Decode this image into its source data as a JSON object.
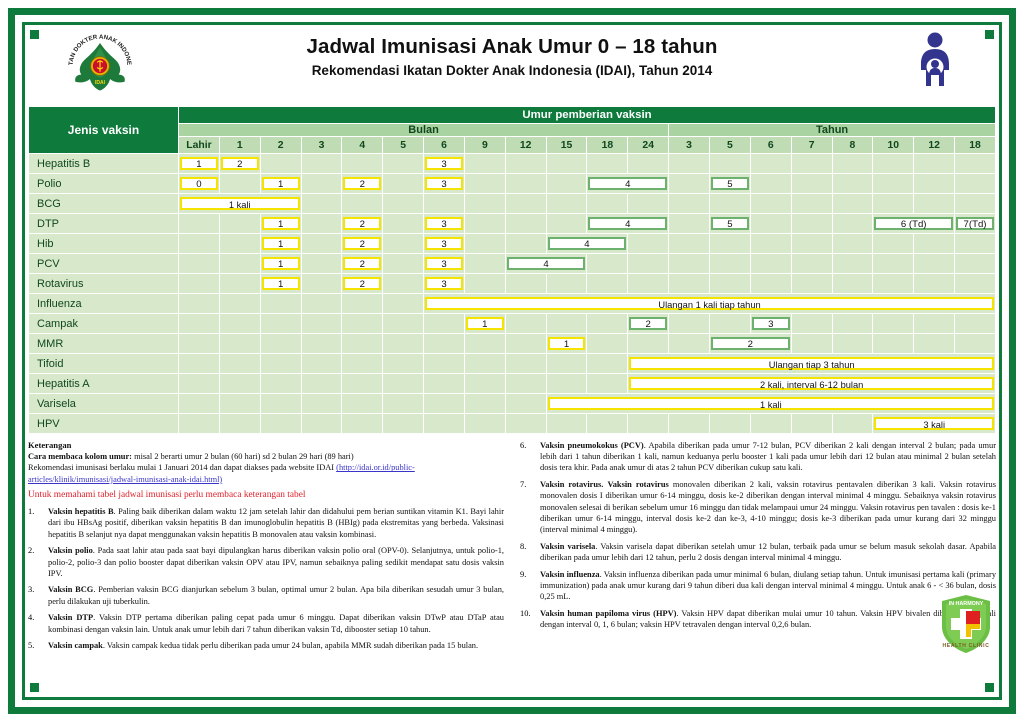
{
  "header": {
    "title": "Jadwal Imunisasi Anak Umur 0 – 18 tahun",
    "subtitle": "Rekomendasi Ikatan Dokter Anak Indonesia (IDAI), Tahun 2014",
    "logo_alt": "idai-logo",
    "logo_text_ring": "IKATAN DOKTER ANAK INDONESIA",
    "logo_text_bottom": "IDAI",
    "parent_icon_alt": "parent-and-child-icon"
  },
  "table": {
    "vaccine_header": "Jenis vaksin",
    "age_header": "Umur pemberian vaksin",
    "month_band": "Bulan",
    "year_band": "Tahun",
    "month_cols": [
      "Lahir",
      "1",
      "2",
      "3",
      "4",
      "5",
      "6",
      "9",
      "12",
      "15",
      "18",
      "24"
    ],
    "year_cols": [
      "3",
      "5",
      "6",
      "7",
      "8",
      "10",
      "12",
      "18"
    ],
    "rows": [
      {
        "name": "Hepatitis  B",
        "cells": [
          {
            "col": 0,
            "span": 1,
            "label": "1",
            "style": "y"
          },
          {
            "col": 1,
            "span": 1,
            "label": "2",
            "style": "y"
          },
          {
            "col": 6,
            "span": 1,
            "label": "3",
            "style": "y"
          }
        ]
      },
      {
        "name": "Polio",
        "cells": [
          {
            "col": 0,
            "span": 1,
            "label": "0",
            "style": "y"
          },
          {
            "col": 2,
            "span": 1,
            "label": "1",
            "style": "y"
          },
          {
            "col": 4,
            "span": 1,
            "label": "2",
            "style": "y"
          },
          {
            "col": 6,
            "span": 1,
            "label": "3",
            "style": "y"
          },
          {
            "col": 10,
            "span": 2,
            "label": "4",
            "style": "g"
          },
          {
            "col": 13,
            "span": 1,
            "label": "5",
            "style": "g"
          }
        ]
      },
      {
        "name": "BCG",
        "cells": [
          {
            "col": 0,
            "span": 3,
            "label": "1 kali",
            "style": "y"
          }
        ]
      },
      {
        "name": "DTP",
        "cells": [
          {
            "col": 2,
            "span": 1,
            "label": "1",
            "style": "y"
          },
          {
            "col": 4,
            "span": 1,
            "label": "2",
            "style": "y"
          },
          {
            "col": 6,
            "span": 1,
            "label": "3",
            "style": "y"
          },
          {
            "col": 10,
            "span": 2,
            "label": "4",
            "style": "g"
          },
          {
            "col": 13,
            "span": 1,
            "label": "5",
            "style": "g"
          },
          {
            "col": 17,
            "span": 2,
            "label": "6 (Td)",
            "style": "g"
          },
          {
            "col": 19,
            "span": 1,
            "label": "7(Td)",
            "style": "g"
          }
        ]
      },
      {
        "name": "Hib",
        "cells": [
          {
            "col": 2,
            "span": 1,
            "label": "1",
            "style": "y"
          },
          {
            "col": 4,
            "span": 1,
            "label": "2",
            "style": "y"
          },
          {
            "col": 6,
            "span": 1,
            "label": "3",
            "style": "y"
          },
          {
            "col": 9,
            "span": 2,
            "label": "4",
            "style": "g"
          }
        ]
      },
      {
        "name": "PCV",
        "cells": [
          {
            "col": 2,
            "span": 1,
            "label": "1",
            "style": "y"
          },
          {
            "col": 4,
            "span": 1,
            "label": "2",
            "style": "y"
          },
          {
            "col": 6,
            "span": 1,
            "label": "3",
            "style": "y"
          },
          {
            "col": 8,
            "span": 2,
            "label": "4",
            "style": "g"
          }
        ]
      },
      {
        "name": "Rotavirus",
        "cells": [
          {
            "col": 2,
            "span": 1,
            "label": "1",
            "style": "y"
          },
          {
            "col": 4,
            "span": 1,
            "label": "2",
            "style": "y"
          },
          {
            "col": 6,
            "span": 1,
            "label": "3",
            "style": "y"
          }
        ]
      },
      {
        "name": "Influenza",
        "cells": [
          {
            "col": 6,
            "span": 14,
            "label": "Ulangan 1 kali tiap tahun",
            "style": "y"
          }
        ]
      },
      {
        "name": "Campak",
        "cells": [
          {
            "col": 7,
            "span": 1,
            "label": "1",
            "style": "y"
          },
          {
            "col": 11,
            "span": 1,
            "label": "2",
            "style": "g"
          },
          {
            "col": 14,
            "span": 1,
            "label": "3",
            "style": "g"
          }
        ]
      },
      {
        "name": "MMR",
        "cells": [
          {
            "col": 9,
            "span": 1,
            "label": "1",
            "style": "y"
          },
          {
            "col": 13,
            "span": 2,
            "label": "2",
            "style": "g"
          }
        ]
      },
      {
        "name": "Tifoid",
        "cells": [
          {
            "col": 11,
            "span": 9,
            "label": "Ulangan tiap 3 tahun",
            "style": "y"
          }
        ]
      },
      {
        "name": "Hepatitis  A",
        "cells": [
          {
            "col": 11,
            "span": 9,
            "label": "2 kali, interval 6-12 bulan",
            "style": "y"
          }
        ]
      },
      {
        "name": "Varisela",
        "cells": [
          {
            "col": 9,
            "span": 11,
            "label": "1 kali",
            "style": "y"
          }
        ]
      },
      {
        "name": "HPV",
        "cells": [
          {
            "col": 17,
            "span": 3,
            "label": "3 kali",
            "style": "y"
          }
        ]
      }
    ]
  },
  "keterangan": {
    "title": "Keterangan",
    "line1_bold": "Cara membaca kolom umur:",
    "line1_rest": " misal    2    berarti umur 2 bulan (60 hari) sd 2 bulan 29 hari (89 hari)",
    "line2": "Rekomendasi imunisasi berlaku mulai 1 Januari 2014 dan dapat diakses pada website IDAI ",
    "link": "(http://idai.or.id/public-articles/klinik/imunisasi/jadwal-imunisasi-anak-idai.html)",
    "red_note": "Untuk memahami tabel jadwal imunisasi perlu membaca keterangan tabel"
  },
  "footnotes_left": [
    {
      "num": "1.",
      "bold": "Vaksin hepatitis B",
      "text": ". Paling baik diberikan dalam waktu 12 jam setelah lahir dan didahului pem berian suntikan vitamin K1. Bayi lahir dari ibu HBsAg positif, diberikan vaksin hepatitis B dan imunoglobulin hepatitis B (HBIg) pada ekstremitas yang berbeda.  Vaksinasi hepatitis B selanjut nya dapat menggunakan vaksin hepatitis B monovalen atau vaksin kombinasi."
    },
    {
      "num": "2.",
      "bold": "Vaksin polio",
      "text": ". Pada saat lahir atau pada saat bayi dipulangkan harus diberikan vaksin polio oral (OPV-0). Selanjutnya, untuk polio-1, polio-2, polio-3 dan polio booster dapat diberikan vaksin OPV atau IPV, namun sebaiknya paling sedikit mendapat  satu dosis vaksin IPV."
    },
    {
      "num": "3.",
      "bold": "Vaksin BCG",
      "text": ". Pemberian vaksin BCG dianjurkan sebelum 3 bulan, optimal umur 2 bulan. Apa bila diberikan sesudah umur 3 bulan, perlu dilakukan uji tuberkulin."
    },
    {
      "num": "4.",
      "bold": "Vaksin DTP",
      "text": ". Vaksin DTP pertama diberikan paling cepat pada umur 6 minggu. Dapat diberikan vaksin DTwP atau DTaP atau kombinasi dengan vaksin lain. Untuk anak umur lebih dari 7 tahun diberikan vaksin Td, dibooster setiap 10 tahun."
    },
    {
      "num": "5.",
      "bold": "Vaksin campak",
      "text": ". Vaksin campak kedua tidak perlu diberikan pada umur 24 bulan, apabila MMR sudah diberikan pada 15 bulan."
    }
  ],
  "footnotes_right": [
    {
      "num": "6.",
      "bold": "Vaksin pneumokokus (PCV)",
      "text": ". Apabila diberikan pada umur 7-12 bulan, PCV diberikan 2 kali dengan interval 2 bulan; pada umur lebih dari 1 tahun diberikan 1 kali, namun keduanya perlu booster 1 kali pada umur lebih dari 12 bulan atau minimal 2 bulan setelah dosis tera khir. Pada anak umur di atas 2 tahun PCV diberikan cukup satu kali."
    },
    {
      "num": "7.",
      "bold": "Vaksin rotavirus.",
      "text": " <b>Vaksin rotavirus</b> monovalen diberikan 2 kali, vaksin rotavirus pentavalen diberikan 3 kali. Vaksin rotavirus monovalen dosis I diberikan umur 6-14 minggu, dosis ke-2 diberikan dengan interval minimal 4 minggu. Sebaiknya vaksin rotavirus monovalen selesai di berikan sebelum umur 16 minggu dan tidak melampaui umur 24 minggu. Vaksin rotavirus pen tavalen : dosis ke-1 diberikan umur 6-14 minggu, interval dosis ke-2 dan ke-3, 4-10 minggu; dosis ke-3 diberikan pada umur kurang dari 32 minggu (interval minimal 4 minggu)."
    },
    {
      "num": "8.",
      "bold": "Vaksin varisela",
      "text": ". Vaksin varisela dapat diberikan setelah umur 12 bulan, terbaik pada umur se belum masuk sekolah dasar. Apabila diberikan pada umur lebih dari 12 tahun, perlu 2 dosis dengan interval minimal 4 minggu."
    },
    {
      "num": "9.",
      "bold": "Vaksin influenza",
      "text": ". Vaksin influenza diberikan pada umur minimal 6 bulan, diulang setiap tahun. Untuk imunisasi pertama kali (primary immunization) pada anak umur kurang dari  9 tahun diberi dua kali dengan interval minimal 4 minggu. Untuk anak 6 - &lt; 36 bulan, dosis 0,25 mL."
    },
    {
      "num": "10.",
      "bold": "Vaksin human papiloma virus (HPV)",
      "text": ". Vaksin HPV dapat diberikan mulai umur 10 tahun. Vaksin HPV bivalen diberikan tiga kali dengan interval 0, 1, 6 bulan; vaksin HPV tetravalen dengan interval 0,2,6 bulan."
    }
  ],
  "clinic_logo": {
    "top_text": "IN HARMONY",
    "bottom_text": "HEALTH CLINIC"
  },
  "colors": {
    "frame_green": "#0e7a3c",
    "header_green": "#0e7a3c",
    "band_green": "#a9d3a0",
    "cell_green": "#d7e9ca",
    "chip_yellow": "#f5e400",
    "chip_green": "#6cb26e",
    "red_note": "#e0202a",
    "link_blue": "#3a35c8"
  }
}
